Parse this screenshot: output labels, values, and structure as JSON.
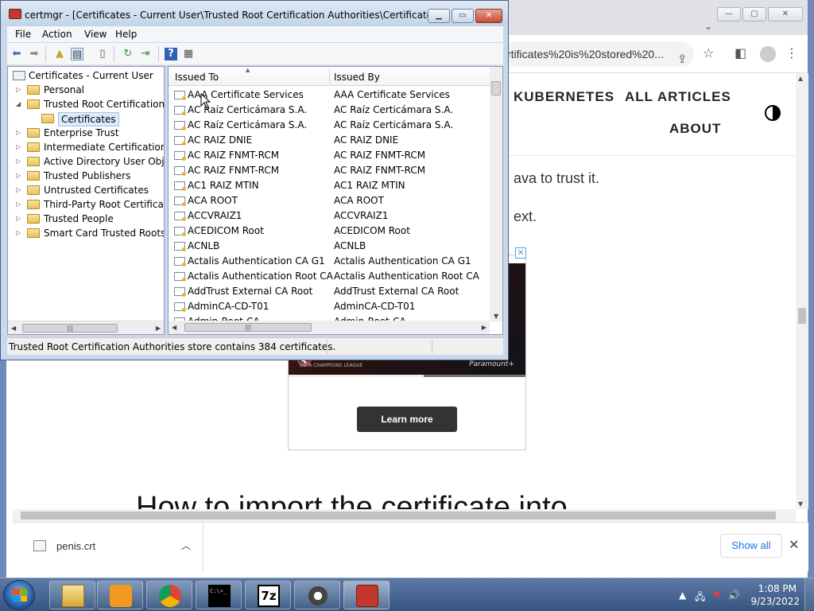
{
  "browser": {
    "url": "rtificates%20is%20stored%20...",
    "nav": {
      "kubernetes": "KUBERNETES",
      "all_articles": "ALL ARTICLES",
      "about": "ABOUT"
    },
    "body_lines": [
      "ava to trust it.",
      "ext."
    ],
    "ad": {
      "brand": "Paramount+",
      "caption": "UEFA CHAMPIONS LEAGUE",
      "learn_more": "Learn more"
    },
    "heading": "How to import the certificate into",
    "download": {
      "file_name": "penis.crt",
      "show_all": "Show all"
    }
  },
  "certmgr": {
    "title": "certmgr - [Certificates - Current User\\Trusted Root Certification Authorities\\Certificates]",
    "menu": [
      "File",
      "Action",
      "View",
      "Help"
    ],
    "tree": {
      "root": "Certificates - Current User",
      "nodes": [
        {
          "label": "Personal",
          "expander": "▷"
        },
        {
          "label": "Trusted Root Certification Au",
          "expander": "◢"
        },
        {
          "label": "Certificates",
          "expander": ""
        },
        {
          "label": "Enterprise Trust",
          "expander": "▷"
        },
        {
          "label": "Intermediate Certification Au",
          "expander": "▷"
        },
        {
          "label": "Active Directory User Object",
          "expander": "▷"
        },
        {
          "label": "Trusted Publishers",
          "expander": "▷"
        },
        {
          "label": "Untrusted Certificates",
          "expander": "▷"
        },
        {
          "label": "Third-Party Root Certification",
          "expander": "▷"
        },
        {
          "label": "Trusted People",
          "expander": "▷"
        },
        {
          "label": "Smart Card Trusted Roots",
          "expander": "▷"
        }
      ]
    },
    "columns": {
      "issued_to": "Issued To",
      "issued_by": "Issued By"
    },
    "rows": [
      {
        "to": "AAA Certificate Services",
        "by": "AAA Certificate Services"
      },
      {
        "to": "AC Raíz Certicámara S.A.",
        "by": "AC Raíz Certicámara S.A."
      },
      {
        "to": "AC Raíz Certicámara S.A.",
        "by": "AC Raíz Certicámara S.A."
      },
      {
        "to": "AC RAIZ DNIE",
        "by": "AC RAIZ DNIE"
      },
      {
        "to": "AC RAIZ FNMT-RCM",
        "by": "AC RAIZ FNMT-RCM"
      },
      {
        "to": "AC RAIZ FNMT-RCM",
        "by": "AC RAIZ FNMT-RCM"
      },
      {
        "to": "AC1 RAIZ MTIN",
        "by": "AC1 RAIZ MTIN"
      },
      {
        "to": "ACA ROOT",
        "by": "ACA ROOT"
      },
      {
        "to": "ACCVRAIZ1",
        "by": "ACCVRAIZ1"
      },
      {
        "to": "ACEDICOM Root",
        "by": "ACEDICOM Root"
      },
      {
        "to": "ACNLB",
        "by": "ACNLB"
      },
      {
        "to": "Actalis Authentication CA G1",
        "by": "Actalis Authentication CA G1"
      },
      {
        "to": "Actalis Authentication Root CA",
        "by": "Actalis Authentication Root CA"
      },
      {
        "to": "AddTrust External CA Root",
        "by": "AddTrust External CA Root"
      },
      {
        "to": "AdminCA-CD-T01",
        "by": "AdminCA-CD-T01"
      },
      {
        "to": "Admin-Root-CA",
        "by": "Admin-Root-CA"
      }
    ],
    "status": "Trusted Root Certification Authorities store contains 384 certificates."
  },
  "taskbar": {
    "time": "1:08 PM",
    "date": "9/23/2022",
    "cmd_label": "C:\\>_",
    "sevenzip_label": "7z"
  }
}
